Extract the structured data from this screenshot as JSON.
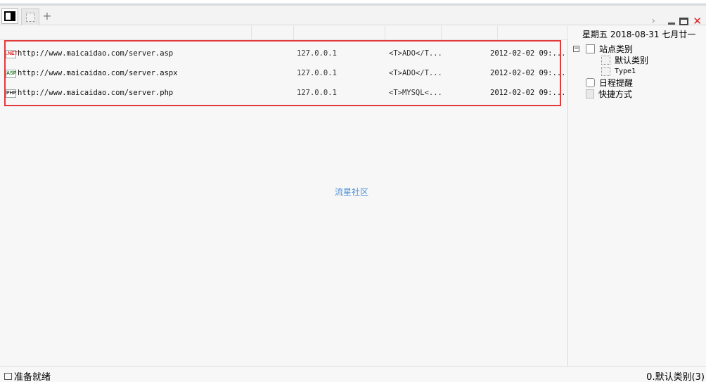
{
  "tabs": {
    "add_label": "+"
  },
  "window": {
    "chevron": "›",
    "close": "✕"
  },
  "rows": [
    {
      "tag": ".NET",
      "url": "http://www.maicaidao.com/server.asp",
      "ip": "127.0.0.1",
      "db": "<T>ADO</T...",
      "date": "2012-02-02 09:..."
    },
    {
      "tag": "ASP",
      "url": "http://www.maicaidao.com/server.aspx",
      "ip": "127.0.0.1",
      "db": "<T>ADO</T...",
      "date": "2012-02-02 09:..."
    },
    {
      "tag": "PHP",
      "url": "http://www.maicaidao.com/server.php",
      "ip": "127.0.0.1",
      "db": "<T>MYSQL<...",
      "date": "2012-02-02 09:..."
    }
  ],
  "watermark": "流星社区",
  "side": {
    "date": "星期五 2018-08-31 七月廿一",
    "tree": {
      "root_label": "站点类别",
      "expander": "−",
      "children": [
        "默认类别",
        "Type1"
      ],
      "schedule_label": "日程提醒",
      "shortcut_label": "快捷方式"
    }
  },
  "status": {
    "left": "准备就绪",
    "right": "0.默认类别(3)"
  },
  "colors": {
    "highlight_border": "#e23a3a",
    "watermark": "#4a90d9",
    "close": "#e02020"
  }
}
